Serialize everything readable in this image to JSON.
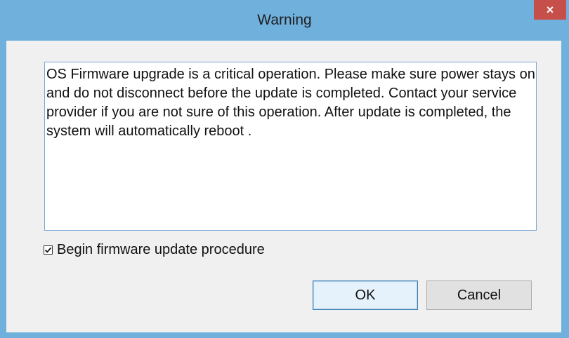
{
  "window": {
    "title": "Warning",
    "close_glyph": "×"
  },
  "message": {
    "text": "OS Firmware upgrade is a critical operation. Please make sure power stays on and do not disconnect before the update is completed. Contact your service provider if you are not sure of this operation. After update is completed, the system will automatically reboot ."
  },
  "checkbox": {
    "label": "Begin firmware update procedure",
    "checked": true
  },
  "buttons": {
    "ok_label": "OK",
    "cancel_label": "Cancel"
  },
  "colors": {
    "titlebar": "#6fb0dc",
    "close_button": "#c74f4a",
    "client_background": "#f0f0f0",
    "focus_border": "#3c7fb1"
  },
  "icons": {
    "close": "close-icon",
    "check": "checkmark-icon"
  }
}
